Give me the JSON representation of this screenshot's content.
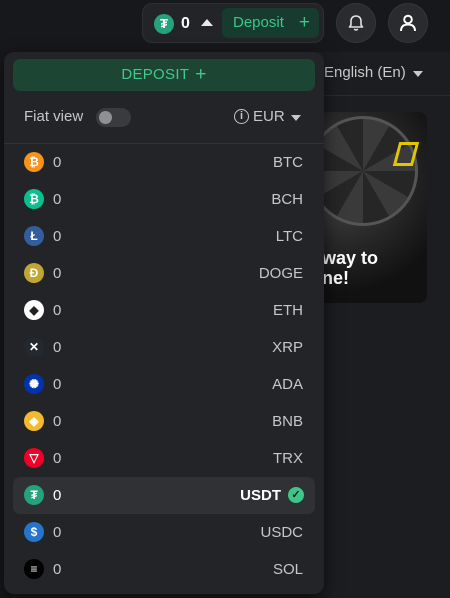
{
  "header": {
    "balance_amount": "0",
    "balance_coin_icon": "usdt-icon",
    "deposit_label": "Deposit",
    "bell_icon": "bell-icon",
    "user_icon": "user-icon"
  },
  "background": {
    "language_label": "English (En)",
    "promo_text_line1": "way to",
    "promo_text_line2": "ne!"
  },
  "dropdown": {
    "deposit_label": "DEPOSIT",
    "fiat_view_label": "Fiat view",
    "fiat_view_on": false,
    "currency_label": "EUR",
    "coins": [
      {
        "symbol": "BTC",
        "amount": "0",
        "color": "#f7931a",
        "glyph": "₿"
      },
      {
        "symbol": "BCH",
        "amount": "0",
        "color": "#0ac18e",
        "glyph": "₿"
      },
      {
        "symbol": "LTC",
        "amount": "0",
        "color": "#345d9d",
        "glyph": "Ł"
      },
      {
        "symbol": "DOGE",
        "amount": "0",
        "color": "#c2a633",
        "glyph": "Ð"
      },
      {
        "symbol": "ETH",
        "amount": "0",
        "color": "#ffffff",
        "glyph": "◆"
      },
      {
        "symbol": "XRP",
        "amount": "0",
        "color": "#23292f",
        "glyph": "✕"
      },
      {
        "symbol": "ADA",
        "amount": "0",
        "color": "#0033ad",
        "glyph": "✺"
      },
      {
        "symbol": "BNB",
        "amount": "0",
        "color": "#f3ba2f",
        "glyph": "◈"
      },
      {
        "symbol": "TRX",
        "amount": "0",
        "color": "#ef0027",
        "glyph": "▽"
      },
      {
        "symbol": "USDT",
        "amount": "0",
        "color": "#26a17b",
        "glyph": "₮",
        "selected": true
      },
      {
        "symbol": "USDC",
        "amount": "0",
        "color": "#2775ca",
        "glyph": "$"
      },
      {
        "symbol": "SOL",
        "amount": "0",
        "color": "#000000",
        "glyph": "≡"
      }
    ]
  }
}
